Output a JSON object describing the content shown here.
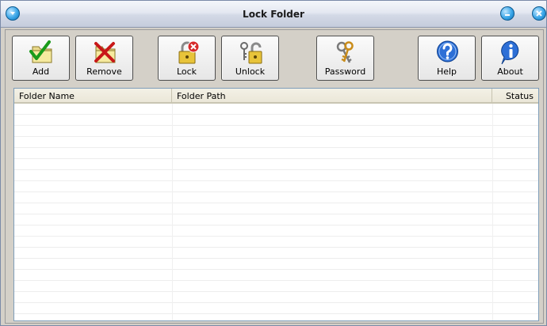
{
  "window": {
    "title": "Lock Folder"
  },
  "toolbar": {
    "buttons": [
      {
        "id": "add",
        "label": "Add",
        "icon": "folder-check-icon"
      },
      {
        "id": "remove",
        "label": "Remove",
        "icon": "folder-x-icon"
      },
      {
        "id": "lock",
        "label": "Lock",
        "icon": "lock-icon"
      },
      {
        "id": "unlock",
        "label": "Unlock",
        "icon": "unlock-keys-icon"
      },
      {
        "id": "password",
        "label": "Password",
        "icon": "keys-icon"
      },
      {
        "id": "help",
        "label": "Help",
        "icon": "help-icon"
      },
      {
        "id": "about",
        "label": "About",
        "icon": "info-icon"
      }
    ]
  },
  "list": {
    "columns": [
      "Folder Name",
      "Folder Path",
      "Status"
    ],
    "rows": []
  }
}
